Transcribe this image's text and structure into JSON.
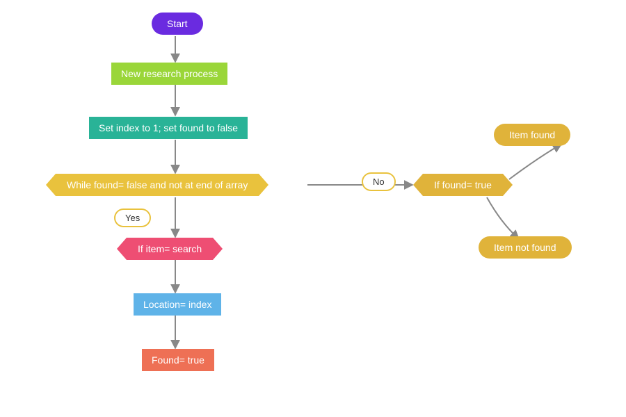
{
  "nodes": {
    "start": {
      "label": "Start",
      "color": "#6a2be0"
    },
    "new_research": {
      "label": "New research process",
      "color": "#9ad639"
    },
    "set_index": {
      "label": "Set index to 1; set found to false",
      "color": "#29b397"
    },
    "while_cond": {
      "label": "While found= false and not at end of array",
      "color": "#e9c23d"
    },
    "if_item": {
      "label": "If item= search",
      "color": "#ee4e73"
    },
    "location": {
      "label": "Location= index",
      "color": "#5fb3e8"
    },
    "found_true": {
      "label": "Found= true",
      "color": "#ee7055"
    },
    "if_found": {
      "label": "If found= true",
      "color": "#e0b33a"
    },
    "item_found": {
      "label": "Item found",
      "color": "#e0b33a"
    },
    "item_not_found": {
      "label": "Item not found",
      "color": "#e0b33a"
    }
  },
  "edge_labels": {
    "yes": "Yes",
    "no": "No"
  }
}
